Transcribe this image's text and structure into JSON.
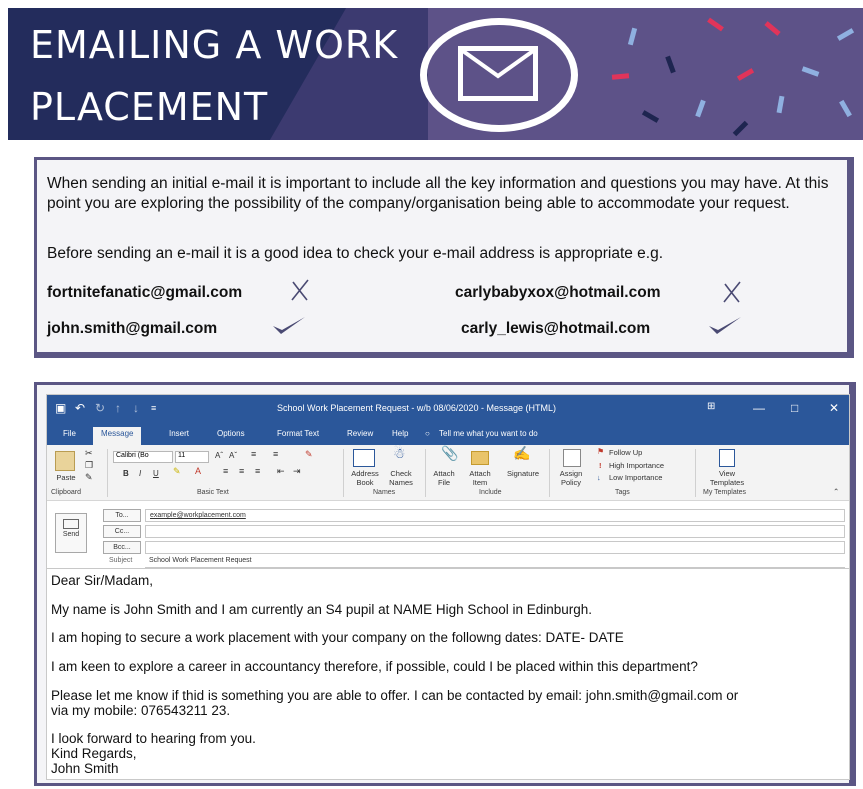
{
  "banner": {
    "title_line1": "EMAILING A WORK",
    "title_line2": "PLACEMENT"
  },
  "info": {
    "paragraph1": "When sending an initial e-mail it is important to include all the key information and questions you may have. At this point you are exploring the possibility of the company/organisation being able to accommodate your request.",
    "paragraph2": "Before sending an e-mail it is a good idea to check your e-mail address is appropriate e.g.",
    "examples": [
      {
        "address": "fortnitefanatic@gmail.com",
        "verdict": "wrong"
      },
      {
        "address": "carlybabyxox@hotmail.com",
        "verdict": "wrong"
      },
      {
        "address": "john.smith@gmail.com",
        "verdict": "right"
      },
      {
        "address": "carly_lewis@hotmail.com",
        "verdict": "right"
      }
    ]
  },
  "outlook": {
    "window_title": "School Work Placement Request - w/b 08/06/2020 - Message (HTML)",
    "tabs": [
      "File",
      "Message",
      "Insert",
      "Options",
      "Format Text",
      "Review",
      "Help"
    ],
    "tell_me": "Tell me what you want to do",
    "ribbon": {
      "paste": "Paste",
      "font": "Calibri (Bo",
      "font_size": "11",
      "address_book": "Address Book",
      "check_names": "Check Names",
      "attach_file": "Attach File",
      "attach_item": "Attach Item",
      "signature": "Signature",
      "assign_policy": "Assign Policy",
      "follow_up": "Follow Up",
      "high_importance": "High Importance",
      "low_importance": "Low Importance",
      "view_templates": "View Templates",
      "groups": [
        "Clipboard",
        "Basic Text",
        "Names",
        "Include",
        "Tags",
        "My Templates"
      ]
    },
    "send": "Send",
    "to_label": "To...",
    "cc_label": "Cc...",
    "bcc_label": "Bcc...",
    "subject_label": "Subject",
    "to_value": "example@workplacement.com",
    "subject_value": "School Work Placement Request",
    "body": [
      "Dear Sir/Madam,",
      "My name is John Smith and I am currently an S4 pupil at NAME High School in Edinburgh.",
      "I am hoping to secure a work placement with your company on the followng dates: DATE- DATE",
      "I am keen to explore a career in accountancy therefore, if possible, could I be placed within this department?",
      "Please let me know if thid is something you are able to offer. I can be contacted by email: john.smith@gmail.com or",
      "via my mobile: 076543211 23.",
      "I look forward to hearing from you.",
      "Kind Regards,",
      "John Smith"
    ]
  },
  "colors": {
    "banner_dark": "#232c5c",
    "banner_purple": "#5d5288",
    "frame": "#5b5684",
    "outlook_blue": "#2b579a"
  }
}
